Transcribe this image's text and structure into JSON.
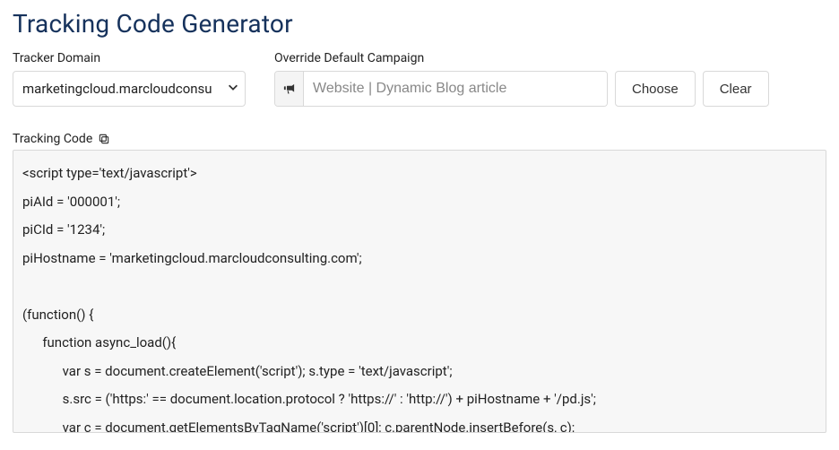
{
  "title": "Tracking Code Generator",
  "trackerDomain": {
    "label": "Tracker Domain",
    "selected": "marketingcloud.marcloudconsu"
  },
  "campaign": {
    "label": "Override Default Campaign",
    "placeholder": "Website | Dynamic Blog article",
    "chooseLabel": "Choose",
    "clearLabel": "Clear"
  },
  "tracking": {
    "label": "Tracking Code",
    "code": "<script type='text/javascript'>\npiAId = '000001';\npiCId = '1234';\npiHostname = 'marketingcloud.marcloudconsulting.com';\n\n(function() {\n      function async_load(){\n            var s = document.createElement('script'); s.type = 'text/javascript';\n            s.src = ('https:' == document.location.protocol ? 'https://' : 'http://') + piHostname + '/pd.js';\n            var c = document.getElementsByTagName('script')[0]; c.parentNode.insertBefore(s, c);"
  }
}
